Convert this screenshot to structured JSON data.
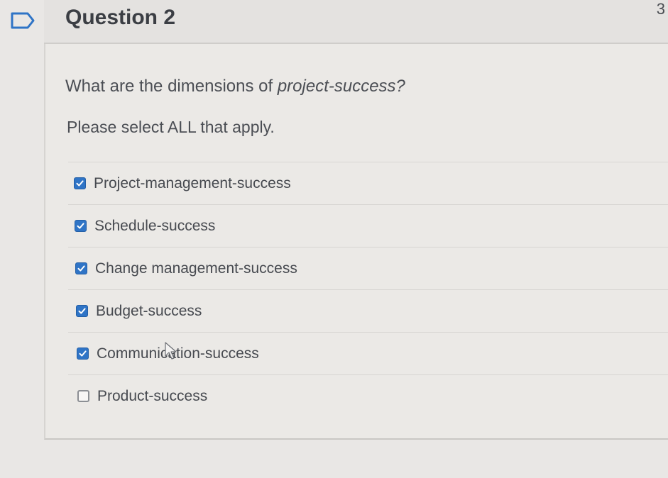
{
  "question": {
    "title": "Question 2",
    "points": "3",
    "prompt_prefix": "What are the dimensions of ",
    "prompt_emphasis": "project-success?",
    "instruction": "Please select ALL that apply."
  },
  "answers": [
    {
      "label": "Project-management-success",
      "checked": true
    },
    {
      "label": "Schedule-success",
      "checked": true
    },
    {
      "label": "Change management-success",
      "checked": true
    },
    {
      "label": "Budget-success",
      "checked": true
    },
    {
      "label": "Communication-success",
      "checked": true
    },
    {
      "label": "Product-success",
      "checked": false
    }
  ],
  "icons": {
    "flag": "flag-outline-icon",
    "checkmark": "checkmark-icon",
    "cursor": "mouse-cursor-icon"
  },
  "colors": {
    "checkbox_checked": "#2f74c6",
    "flag_border": "#2f74c6"
  }
}
